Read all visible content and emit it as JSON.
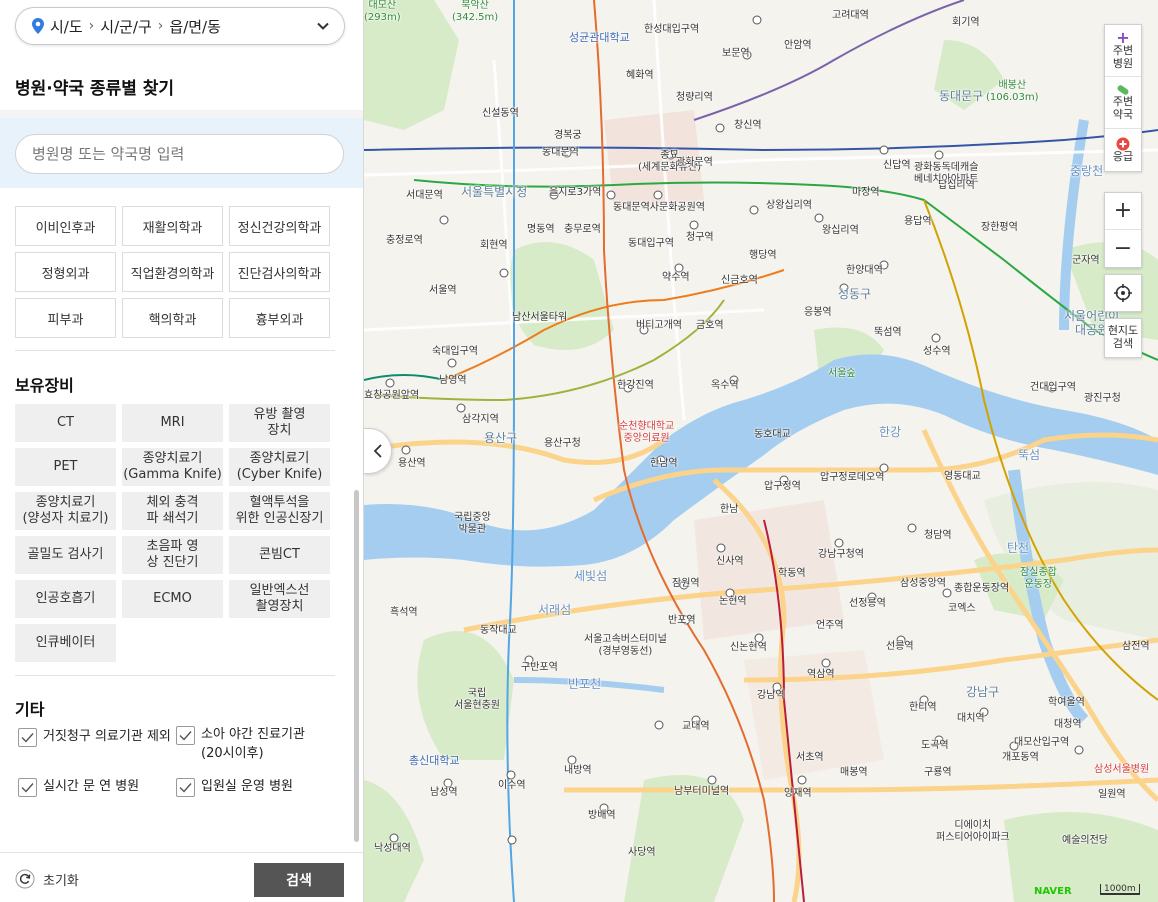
{
  "region": {
    "sido": "시/도",
    "sigungu": "시/군/구",
    "dong": "읍/면/동"
  },
  "finder_title": "병원·약국 종류별 찾기",
  "search": {
    "placeholder": "병원명 또는 약국명 입력"
  },
  "departments": [
    "이비인후과",
    "재활의학과",
    "정신건강의학과",
    "정형외과",
    "직업환경의학과",
    "진단검사의학과",
    "피부과",
    "핵의학과",
    "흉부외과"
  ],
  "equipment": {
    "title": "보유장비",
    "items": [
      "CT",
      "MRI",
      "유방 촬영\n장치",
      "PET",
      "종양치료기\n(Gamma Knife)",
      "종양치료기\n(Cyber Knife)",
      "종양치료기\n(양성자 치료기)",
      "체외 충격\n파 쇄석기",
      "혈액투석을\n위한 인공신장기",
      "골밀도 검사기",
      "초음파 영\n상 진단기",
      "콘빔CT",
      "인공호흡기",
      "ECMO",
      "일반엑스선\n촬영장치",
      "인큐베이터"
    ]
  },
  "etc": {
    "title": "기타",
    "options": [
      "거짓청구 의료기관 제외",
      "소아 야간 진료기관\n(20시이후)",
      "실시간 문 연 병원",
      "입원실 운영 병원"
    ]
  },
  "footer": {
    "reset_label": "초기화",
    "search_label": "검색"
  },
  "map_controls": {
    "nearby_hospital": "주변\n병원",
    "nearby_pharmacy": "주변\n약국",
    "emergency": "응급",
    "zoom_in": "+",
    "zoom_out": "−",
    "locate_search": "현지도\n검색"
  },
  "map": {
    "brand": "NAVER",
    "scale": "1000m",
    "labels": [
      {
        "t": "북악산\n(342.5m)",
        "c": "green"
      },
      {
        "t": "성균관대학교",
        "c": "blue"
      },
      {
        "t": "고려대역"
      },
      {
        "t": "회기역"
      },
      {
        "t": "한성대입구역"
      },
      {
        "t": "보문역"
      },
      {
        "t": "안암역"
      },
      {
        "t": "혜화역"
      },
      {
        "t": "동대문구",
        "c": "big"
      },
      {
        "t": "배봉산\n(106.03m)",
        "c": "green"
      },
      {
        "t": "청량리역"
      },
      {
        "t": "창신역"
      },
      {
        "t": "신설동역"
      },
      {
        "t": "경복궁"
      },
      {
        "t": "종묘\n(세계문화유산)"
      },
      {
        "t": "동대문역"
      },
      {
        "t": "광화문역"
      },
      {
        "t": "광화동독데캐슬\n베네치아아파트"
      },
      {
        "t": "신답역"
      },
      {
        "t": "답십리역"
      },
      {
        "t": "중랑천",
        "c": "water"
      },
      {
        "t": "서대문역"
      },
      {
        "t": "서울특별시청",
        "c": "big"
      },
      {
        "t": "을지로3가역"
      },
      {
        "t": "동대문역사문화공원역"
      },
      {
        "t": "상왕십리역"
      },
      {
        "t": "마장역"
      },
      {
        "t": "용답역"
      },
      {
        "t": "충정로역"
      },
      {
        "t": "회현역"
      },
      {
        "t": "명동역"
      },
      {
        "t": "충무로역"
      },
      {
        "t": "청구역"
      },
      {
        "t": "왕십리역"
      },
      {
        "t": "장한평역"
      },
      {
        "t": "동대입구역"
      },
      {
        "t": "행당역"
      },
      {
        "t": "군자역"
      },
      {
        "t": "서울역"
      },
      {
        "t": "남산서울타워"
      },
      {
        "t": "약수역"
      },
      {
        "t": "신금호역"
      },
      {
        "t": "한양대역"
      },
      {
        "t": "성동구",
        "c": "big"
      },
      {
        "t": "버티고개역"
      },
      {
        "t": "금호역"
      },
      {
        "t": "응봉역"
      },
      {
        "t": "뚝섬역"
      },
      {
        "t": "서울어린이\n대공원",
        "c": "big"
      },
      {
        "t": "숙대입구역"
      },
      {
        "t": "서울숲",
        "c": "green"
      },
      {
        "t": "성수역"
      },
      {
        "t": "남영역"
      },
      {
        "t": "한강진역"
      },
      {
        "t": "옥수역"
      },
      {
        "t": "건대입구역"
      },
      {
        "t": "효창공원앞역"
      },
      {
        "t": "광진구청"
      },
      {
        "t": "삼각지역"
      },
      {
        "t": "순천향대학교\n중앙의료원",
        "c": "red"
      },
      {
        "t": "용산구",
        "c": "big"
      },
      {
        "t": "용산구청"
      },
      {
        "t": "동호대교"
      },
      {
        "t": "한강",
        "c": "water"
      },
      {
        "t": "용산역"
      },
      {
        "t": "한남역"
      },
      {
        "t": "압구정역"
      },
      {
        "t": "압구정로데오역"
      },
      {
        "t": "영동대교"
      },
      {
        "t": "뚝섬",
        "c": "water"
      },
      {
        "t": "국립중앙\n박물관"
      },
      {
        "t": "한남"
      },
      {
        "t": "청담역"
      },
      {
        "t": "신사역"
      },
      {
        "t": "강남구청역"
      },
      {
        "t": "학동역"
      },
      {
        "t": "탄천",
        "c": "water"
      },
      {
        "t": "잠실종합\n운동장",
        "c": "green"
      },
      {
        "t": "세빛섬",
        "c": "water"
      },
      {
        "t": "잠원역"
      },
      {
        "t": "삼성중앙역"
      },
      {
        "t": "서래섬",
        "c": "water"
      },
      {
        "t": "논현역"
      },
      {
        "t": "선정릉역"
      },
      {
        "t": "코엑스"
      },
      {
        "t": "종합운동장역"
      },
      {
        "t": "흑석역"
      },
      {
        "t": "동작대교"
      },
      {
        "t": "반포역"
      },
      {
        "t": "언주역"
      },
      {
        "t": "서울고속버스터미널\n(경부영동선)"
      },
      {
        "t": "신논현역"
      },
      {
        "t": "선릉역"
      },
      {
        "t": "삼전역"
      },
      {
        "t": "구반포역"
      },
      {
        "t": "역삼역"
      },
      {
        "t": "반포천",
        "c": "water"
      },
      {
        "t": "강남역"
      },
      {
        "t": "강남구",
        "c": "big"
      },
      {
        "t": "국립\n서울현충원"
      },
      {
        "t": "한티역"
      },
      {
        "t": "학여울역"
      },
      {
        "t": "대치역"
      },
      {
        "t": "교대역"
      },
      {
        "t": "대청역"
      },
      {
        "t": "서초역"
      },
      {
        "t": "도곡역"
      },
      {
        "t": "대모산입구역"
      },
      {
        "t": "총신대학교",
        "c": "blue"
      },
      {
        "t": "개포동역"
      },
      {
        "t": "내방역"
      },
      {
        "t": "매봉역"
      },
      {
        "t": "구룡역"
      },
      {
        "t": "삼성서울병원",
        "c": "red"
      },
      {
        "t": "남성역"
      },
      {
        "t": "이수역"
      },
      {
        "t": "남부터미널역"
      },
      {
        "t": "양재역"
      },
      {
        "t": "일원역"
      },
      {
        "t": "방배역"
      },
      {
        "t": "디에이치\n퍼스티어아이파크"
      },
      {
        "t": "낙성대역"
      },
      {
        "t": "사당역"
      },
      {
        "t": "예술의전당"
      },
      {
        "t": "대모산\n(293m)",
        "c": "green"
      }
    ]
  }
}
